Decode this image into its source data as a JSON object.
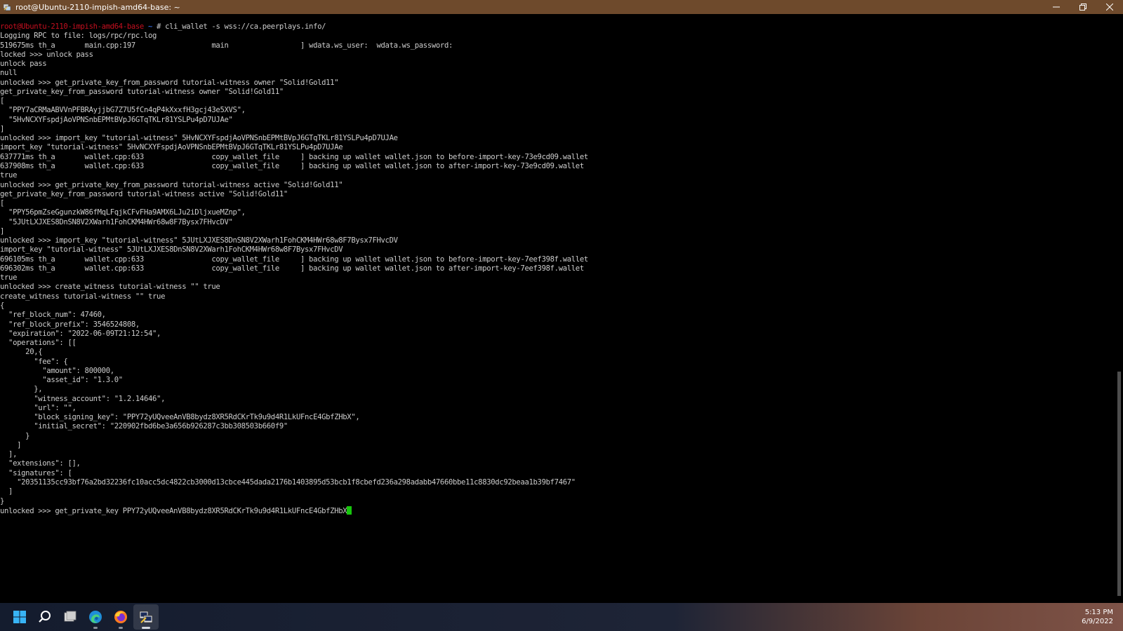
{
  "window": {
    "title": "root@Ubuntu-2110-impish-amd64-base: ~",
    "controls": [
      "minimize-icon",
      "maximize-icon",
      "close-icon"
    ]
  },
  "terminal": {
    "lines": [
      {
        "segs": [
          {
            "t": "root@Ubuntu-2110-impish-amd64-base",
            "c": "red"
          },
          {
            "t": " ~ ",
            "c": "blue"
          },
          {
            "t": "# cli_wallet -s wss://ca.peerplays.info/"
          }
        ]
      },
      {
        "segs": [
          {
            "t": "Logging RPC to file: logs/rpc/rpc.log"
          }
        ]
      },
      {
        "segs": [
          {
            "t": "519675ms th_a       main.cpp:197                  main                 ] wdata.ws_user:  wdata.ws_password:"
          }
        ]
      },
      {
        "segs": [
          {
            "t": "locked >>> unlock pass"
          }
        ]
      },
      {
        "segs": [
          {
            "t": "unlock pass"
          }
        ]
      },
      {
        "segs": [
          {
            "t": "null"
          }
        ]
      },
      {
        "segs": [
          {
            "t": "unlocked >>> get_private_key_from_password tutorial-witness owner \"Solid!Gold11\""
          }
        ]
      },
      {
        "segs": [
          {
            "t": "get_private_key_from_password tutorial-witness owner \"Solid!Gold11\""
          }
        ]
      },
      {
        "segs": [
          {
            "t": "["
          }
        ]
      },
      {
        "segs": [
          {
            "t": "  \"PPY7aCRMaABVVnPFBRAyjjbG7Z7U5fCn4qP4kXxxfH3gcj43e5XVS\","
          }
        ]
      },
      {
        "segs": [
          {
            "t": "  \"5HvNCXYFspdjAoVPNSnbEPMtBVpJ6GTqTKLr81YSLPu4pD7UJAe\""
          }
        ]
      },
      {
        "segs": [
          {
            "t": "]"
          }
        ]
      },
      {
        "segs": [
          {
            "t": "unlocked >>> import_key \"tutorial-witness\" 5HvNCXYFspdjAoVPNSnbEPMtBVpJ6GTqTKLr81YSLPu4pD7UJAe"
          }
        ]
      },
      {
        "segs": [
          {
            "t": "import_key \"tutorial-witness\" 5HvNCXYFspdjAoVPNSnbEPMtBVpJ6GTqTKLr81YSLPu4pD7UJAe"
          }
        ]
      },
      {
        "segs": [
          {
            "t": "637771ms th_a       wallet.cpp:633                copy_wallet_file     ] backing up wallet wallet.json to before-import-key-73e9cd09.wallet"
          }
        ]
      },
      {
        "segs": [
          {
            "t": "637908ms th_a       wallet.cpp:633                copy_wallet_file     ] backing up wallet wallet.json to after-import-key-73e9cd09.wallet"
          }
        ]
      },
      {
        "segs": [
          {
            "t": "true"
          }
        ]
      },
      {
        "segs": [
          {
            "t": "unlocked >>> get_private_key_from_password tutorial-witness active \"Solid!Gold11\""
          }
        ]
      },
      {
        "segs": [
          {
            "t": "get_private_key_from_password tutorial-witness active \"Solid!Gold11\""
          }
        ]
      },
      {
        "segs": [
          {
            "t": "["
          }
        ]
      },
      {
        "segs": [
          {
            "t": "  \"PPY56pmZseGgunzkW86fMqLFqjkCFvFHa9AMX6LJu2iDljxueMZnp\","
          }
        ]
      },
      {
        "segs": [
          {
            "t": "  \"5JUtLXJXES8DnSN8V2XWarh1FohCKM4HWr68w8F7Bysx7FHvcDV\""
          }
        ]
      },
      {
        "segs": [
          {
            "t": "]"
          }
        ]
      },
      {
        "segs": [
          {
            "t": "unlocked >>> import_key \"tutorial-witness\" 5JUtLXJXES8DnSN8V2XWarh1FohCKM4HWr68w8F7Bysx7FHvcDV"
          }
        ]
      },
      {
        "segs": [
          {
            "t": "import_key \"tutorial-witness\" 5JUtLXJXES8DnSN8V2XWarh1FohCKM4HWr68w8F7Bysx7FHvcDV"
          }
        ]
      },
      {
        "segs": [
          {
            "t": "696105ms th_a       wallet.cpp:633                copy_wallet_file     ] backing up wallet wallet.json to before-import-key-7eef398f.wallet"
          }
        ]
      },
      {
        "segs": [
          {
            "t": "696302ms th_a       wallet.cpp:633                copy_wallet_file     ] backing up wallet wallet.json to after-import-key-7eef398f.wallet"
          }
        ]
      },
      {
        "segs": [
          {
            "t": "true"
          }
        ]
      },
      {
        "segs": [
          {
            "t": "unlocked >>> create_witness tutorial-witness \"\" true"
          }
        ]
      },
      {
        "segs": [
          {
            "t": "create_witness tutorial-witness \"\" true"
          }
        ]
      },
      {
        "segs": [
          {
            "t": "{"
          }
        ]
      },
      {
        "segs": [
          {
            "t": "  \"ref_block_num\": 47460,"
          }
        ]
      },
      {
        "segs": [
          {
            "t": "  \"ref_block_prefix\": 3546524808,"
          }
        ]
      },
      {
        "segs": [
          {
            "t": "  \"expiration\": \"2022-06-09T21:12:54\","
          }
        ]
      },
      {
        "segs": [
          {
            "t": "  \"operations\": [["
          }
        ]
      },
      {
        "segs": [
          {
            "t": "      20,{"
          }
        ]
      },
      {
        "segs": [
          {
            "t": "        \"fee\": {"
          }
        ]
      },
      {
        "segs": [
          {
            "t": "          \"amount\": 800000,"
          }
        ]
      },
      {
        "segs": [
          {
            "t": "          \"asset_id\": \"1.3.0\""
          }
        ]
      },
      {
        "segs": [
          {
            "t": "        },"
          }
        ]
      },
      {
        "segs": [
          {
            "t": "        \"witness_account\": \"1.2.14646\","
          }
        ]
      },
      {
        "segs": [
          {
            "t": "        \"url\": \"\","
          }
        ]
      },
      {
        "segs": [
          {
            "t": "        \"block_signing_key\": \"PPY72yUQveeAnVB8bydz8XR5RdCKrTk9u9d4R1LkUFncE4GbfZHbX\","
          }
        ]
      },
      {
        "segs": [
          {
            "t": "        \"initial_secret\": \"220902fbd6be3a656b926287c3bb308503b660f9\""
          }
        ]
      },
      {
        "segs": [
          {
            "t": "      }"
          }
        ]
      },
      {
        "segs": [
          {
            "t": "    ]"
          }
        ]
      },
      {
        "segs": [
          {
            "t": "  ],"
          }
        ]
      },
      {
        "segs": [
          {
            "t": "  \"extensions\": [],"
          }
        ]
      },
      {
        "segs": [
          {
            "t": "  \"signatures\": ["
          }
        ]
      },
      {
        "segs": [
          {
            "t": "    \"20351135cc93bf76a2bd32236fc10acc5dc4822cb3000d13cbce445dada2176b1403895d53bcb1f8cbefd236a298adabb47660bbe11c8830dc92beaa1b39bf7467\""
          }
        ]
      },
      {
        "segs": [
          {
            "t": "  ]"
          }
        ]
      },
      {
        "segs": [
          {
            "t": "}"
          }
        ]
      },
      {
        "segs": [
          {
            "t": "unlocked >>> get_private_key PPY72yUQveeAnVB8bydz8XR5RdCKrTk9u9d4R1LkUFncE4GbfZHbX"
          }
        ],
        "cursor": true
      }
    ]
  },
  "taskbar": {
    "items": [
      {
        "name": "start-button",
        "icon": "windows-logo-icon",
        "state": ""
      },
      {
        "name": "search-button",
        "icon": "search-icon",
        "state": ""
      },
      {
        "name": "task-view-button",
        "icon": "task-view-icon",
        "state": ""
      },
      {
        "name": "edge-button",
        "icon": "edge-icon",
        "state": "running"
      },
      {
        "name": "firefox-button",
        "icon": "firefox-icon",
        "state": "running"
      },
      {
        "name": "putty-button",
        "icon": "putty-icon",
        "state": "active"
      }
    ],
    "clock": {
      "time": "5:13 PM",
      "date": "6/9/2022"
    }
  },
  "colors": {
    "titlebar": "#6e4a2c",
    "terminal_bg": "#000000",
    "terminal_fg": "#cccccc",
    "prompt_user": "#c50f1f",
    "prompt_path": "#3b78ff",
    "cursor": "#16c60c"
  }
}
